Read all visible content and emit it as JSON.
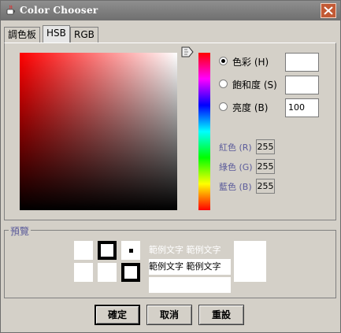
{
  "window": {
    "title": "Color Chooser"
  },
  "tabs": [
    "調色板",
    "HSB",
    "RGB"
  ],
  "hsb": {
    "options": [
      {
        "label": "色彩 (H)",
        "selected": true,
        "value": ""
      },
      {
        "label": "飽和度 (S)",
        "selected": false,
        "value": ""
      },
      {
        "label": "亮度 (B)",
        "selected": false,
        "value": "100"
      }
    ]
  },
  "rgb": [
    {
      "label": "紅色 (R)",
      "value": "255"
    },
    {
      "label": "綠色 (G)",
      "value": "255"
    },
    {
      "label": "藍色 (B)",
      "value": "255"
    }
  ],
  "preview": {
    "title": "預覽",
    "sample_text_1": "範例文字  範例文字",
    "sample_text_2": "範例文字  範例文字"
  },
  "buttons": {
    "ok": "確定",
    "cancel": "取消",
    "reset": "重設"
  },
  "colors": {
    "selected": "#ffffff",
    "title_bar": "#7f7f7f",
    "close": "#c25a35"
  }
}
